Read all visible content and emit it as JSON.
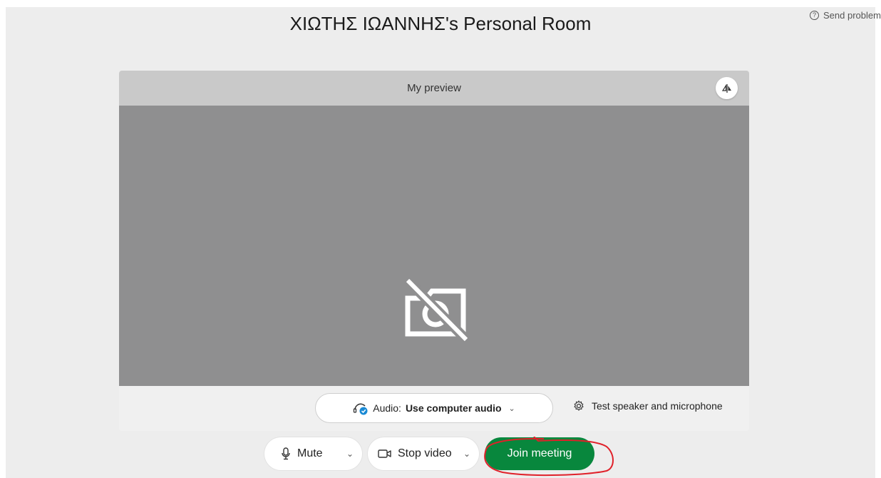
{
  "header": {
    "room_title": "ΧΙΩΤΗΣ ΙΩΑΝΝΗΣ's Personal Room",
    "send_problem_label": "Send problem"
  },
  "preview": {
    "title": "My preview",
    "mirror_icon": "mirror-flip-icon",
    "video_state_icon": "camera-off-icon"
  },
  "audio": {
    "prefix": "Audio:",
    "selected": "Use computer audio",
    "icon": "headset-check-icon"
  },
  "test_speaker": {
    "label": "Test speaker and microphone",
    "icon": "gear-icon"
  },
  "controls": {
    "mute_label": "Mute",
    "stop_video_label": "Stop video",
    "join_label": "Join meeting"
  },
  "colors": {
    "join_button": "#08873d",
    "video_area": "#8f8f90",
    "annotation": "#e0212a"
  }
}
